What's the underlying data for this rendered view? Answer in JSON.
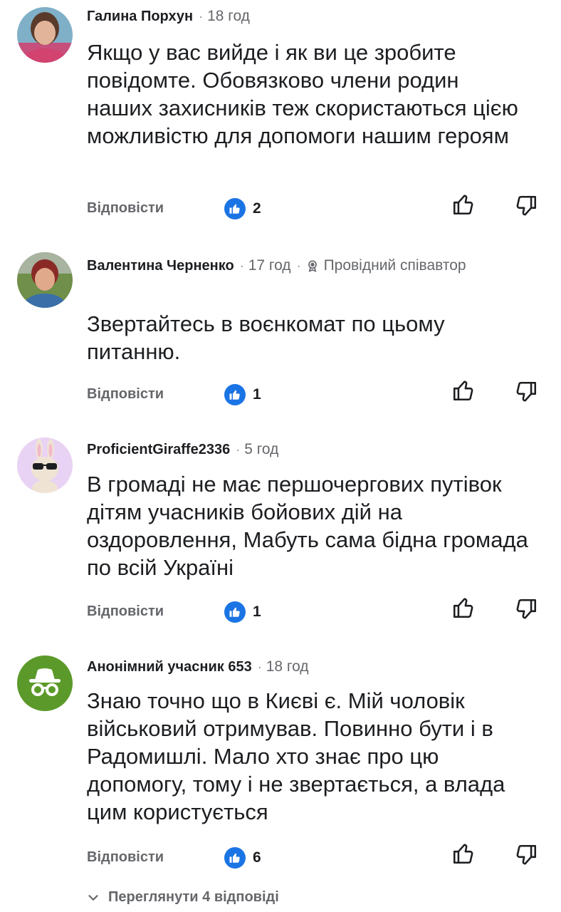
{
  "comments": [
    {
      "author": "Галина Порхун",
      "separator": "·",
      "time": "18 год",
      "text": "Якщо у вас вийде і як ви це зробите повідомте. Обовязково члени родин наших захисників теж скористаються цією можливістю для допомоги нашим героям",
      "reply_label": "Відповісти",
      "like_count": "2",
      "avatar_icon": "person-photo-woman"
    },
    {
      "author": "Валентина Черненко",
      "separator": "·",
      "time": "17 год",
      "separator2": "·",
      "badge": "Провідний співавтор",
      "badge_icon": "award-icon",
      "text": "Звертайтесь в воєнкомат по цьому питанню.",
      "reply_label": "Відповісти",
      "like_count": "1",
      "avatar_icon": "person-photo-woman"
    },
    {
      "author": "ProficientGiraffe2336",
      "separator": "·",
      "time": "5 год",
      "text": "В громаді не має першочергових путівок дітям учасників бойових дій на оздоровлення, Мабуть сама бідна громада по всій Україні",
      "reply_label": "Відповісти",
      "like_count": "1",
      "avatar_icon": "bunny-sunglasses-avatar"
    },
    {
      "author": "Анонімний учасник 653",
      "separator": "·",
      "time": "18 год",
      "text": "Знаю точно що в Києві є. Мій чоловік військовий отримував.  Повинно бути і в Радомишлі.   Мало хто знає про цю допомогу, тому і не звертається, а влада цим користується",
      "reply_label": "Відповісти",
      "like_count": "6",
      "avatar_icon": "anonymous-incognito-avatar"
    }
  ],
  "view_replies": "Переглянути 4 відповіді",
  "colors": {
    "like_blue": "#1b74e4",
    "secondary_text": "#65676b",
    "anonymous_green": "#5b9a2a",
    "bunny_bg": "#e9d3f4"
  }
}
